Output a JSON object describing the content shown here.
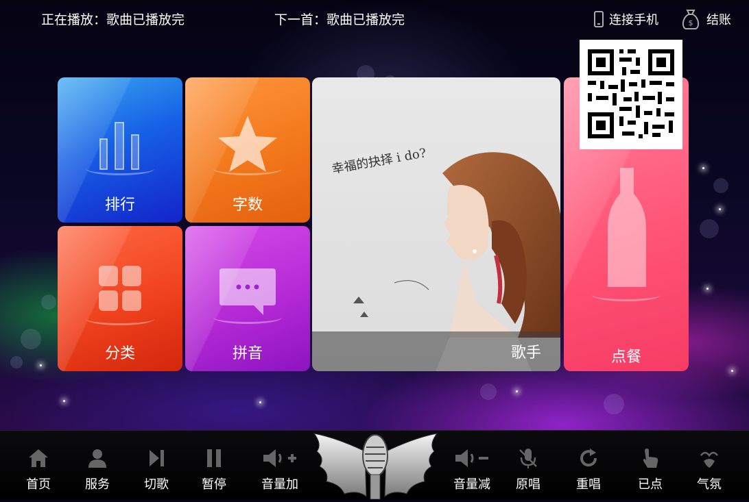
{
  "header": {
    "now_playing": "正在播放：歌曲已播放完",
    "next_song": "下一首：歌曲已播放完",
    "connect_phone": "连接手机",
    "checkout": "结账"
  },
  "tiles": {
    "rank": "排行",
    "chars": "字数",
    "category": "分类",
    "pinyin": "拼音",
    "singer": "歌手",
    "food": "点餐"
  },
  "bottom": {
    "home": "首页",
    "service": "服务",
    "skip": "切歌",
    "pause": "暂停",
    "vol_up": "音量加",
    "vol_down": "音量减",
    "original": "原唱",
    "replay": "重唱",
    "selected": "已点",
    "atmosphere": "气氛"
  },
  "colors": {
    "rank": "#1660e6",
    "chars": "#f47b1e",
    "category": "#f0421e",
    "pinyin": "#b52ad6",
    "food": "#ff5476"
  }
}
